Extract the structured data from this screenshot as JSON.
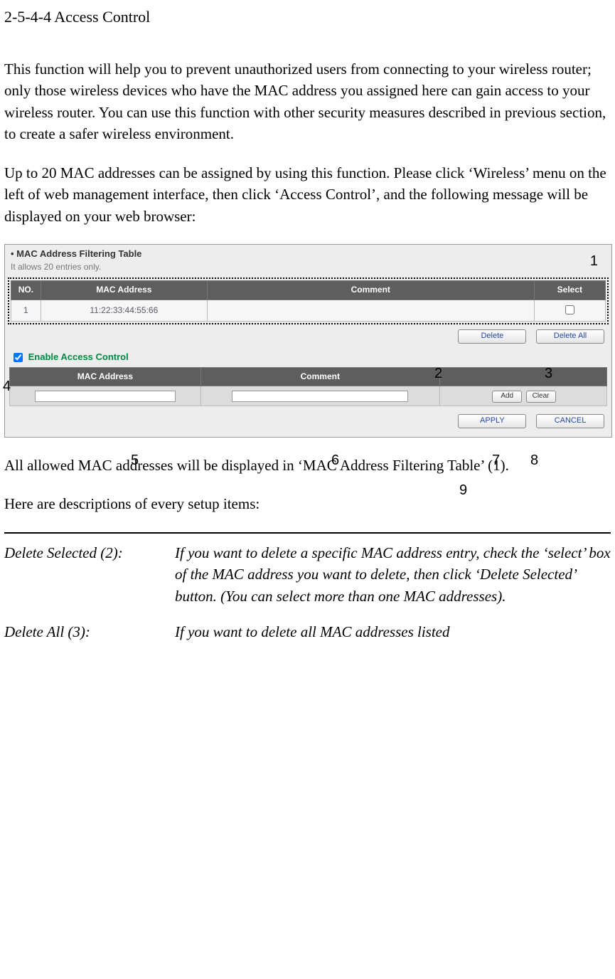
{
  "heading": "2-5-4-4 Access Control",
  "para1": "This function will help you to prevent unauthorized users from connecting to your wireless router; only those wireless devices who have the MAC address you assigned here can gain access to your wireless router. You can use this function with other security measures described in previous section, to create a safer wireless environment.",
  "para2": "Up to 20 MAC addresses can be assigned by using this function. Please click ‘Wireless’ menu on the left of web management interface, then click ‘Access Control’, and the following message will be displayed on your web browser:",
  "figure": {
    "panelTitle": "MAC Address Filtering Table",
    "panelSub": "It allows 20 entries only.",
    "table": {
      "headers": {
        "no": "NO.",
        "mac": "MAC Address",
        "comment": "Comment",
        "select": "Select"
      },
      "rows": [
        {
          "no": "1",
          "mac": "11:22:33:44:55:66",
          "comment": "",
          "selected": false
        }
      ]
    },
    "deleteBtn": "Delete",
    "deleteAllBtn": "Delete All",
    "enableLabel": "Enable Access Control",
    "enableChecked": true,
    "inputTable": {
      "headers": {
        "mac": "MAC Address",
        "comment": "Comment"
      },
      "addBtn": "Add",
      "clearBtn": "Clear"
    },
    "applyBtn": "APPLY",
    "cancelBtn": "CANCEL"
  },
  "callouts": {
    "c1": "1",
    "c2": "2",
    "c3": "3",
    "c4": "4",
    "c5": "5",
    "c6": "6",
    "c7": "7",
    "c8": "8",
    "c9": "9"
  },
  "para3": "All allowed MAC addresses will be displayed in ‘MAC Address Filtering Table’ (1).",
  "para4": "Here are descriptions of every setup items:",
  "descItems": [
    {
      "label": "Delete Selected (2):",
      "body": "If you want to delete a specific MAC address entry, check the ‘select’ box of the MAC address you want to delete, then click ‘Delete Selected’ button. (You can select more than one MAC addresses)."
    },
    {
      "label": "Delete All (3):",
      "body": "If you want to delete all MAC addresses listed"
    }
  ]
}
